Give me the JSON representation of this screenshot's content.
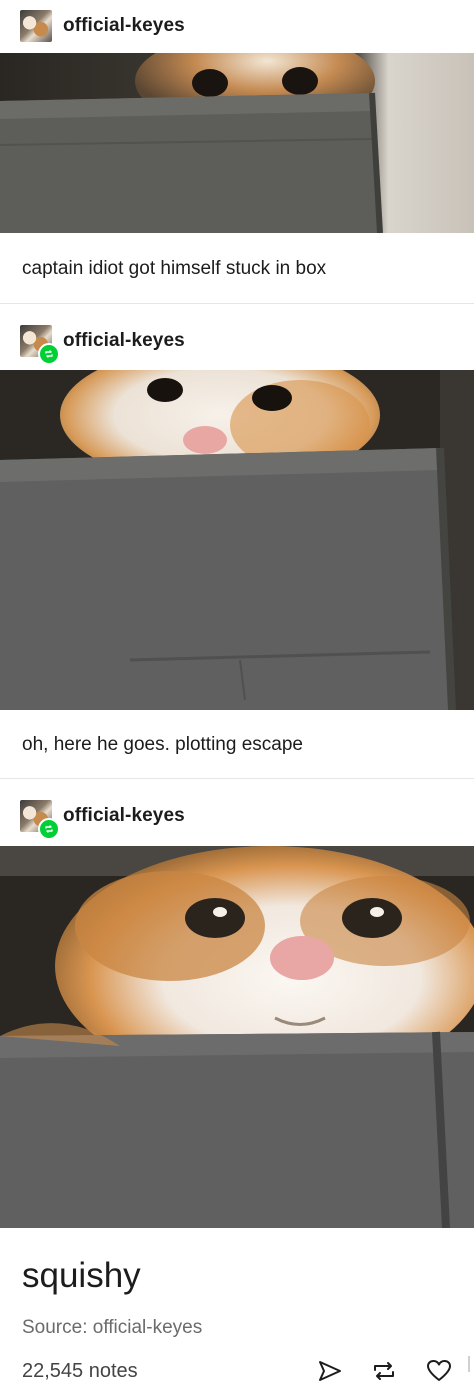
{
  "posts": [
    {
      "username": "official-keyes",
      "reblogged": false,
      "caption": "captain idiot got himself stuck in box",
      "image_alt": "cat peeking over gray fabric storage bin"
    },
    {
      "username": "official-keyes",
      "reblogged": true,
      "caption": "oh, here he goes. plotting escape",
      "image_alt": "cat peeking from inside gray storage bin"
    },
    {
      "username": "official-keyes",
      "reblogged": true,
      "caption": "squishy",
      "image_alt": "cat face squished between shelf and gray bin"
    }
  ],
  "footer": {
    "source": "Source: official-keyes",
    "notes": "22,545 notes"
  },
  "actions": {
    "share_icon": "send-icon",
    "reblog_icon": "reblog-icon",
    "like_icon": "heart-icon"
  },
  "colors": {
    "reblog_badge": "#00cf35",
    "text": "#1c1c1c",
    "muted": "#6b6b6b"
  }
}
